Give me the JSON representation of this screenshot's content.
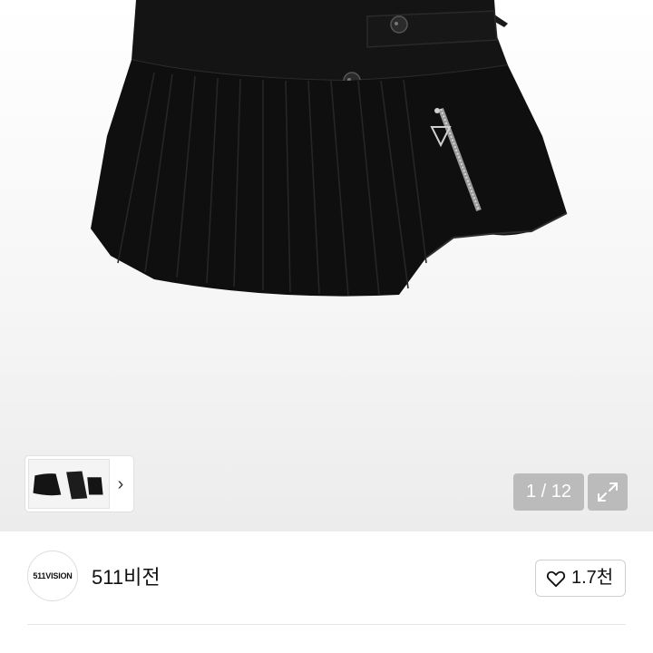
{
  "gallery": {
    "main_image": "black-pleated-mini-skirt",
    "counter": "1 / 12",
    "thumbnail": "skirt-thumbnail",
    "thumb_next_icon": "chevron-right-icon",
    "expand_icon": "expand-icon"
  },
  "shop": {
    "avatar_text": "511VISION",
    "name": "511비전"
  },
  "like": {
    "icon": "heart-icon",
    "count": "1.7천"
  }
}
